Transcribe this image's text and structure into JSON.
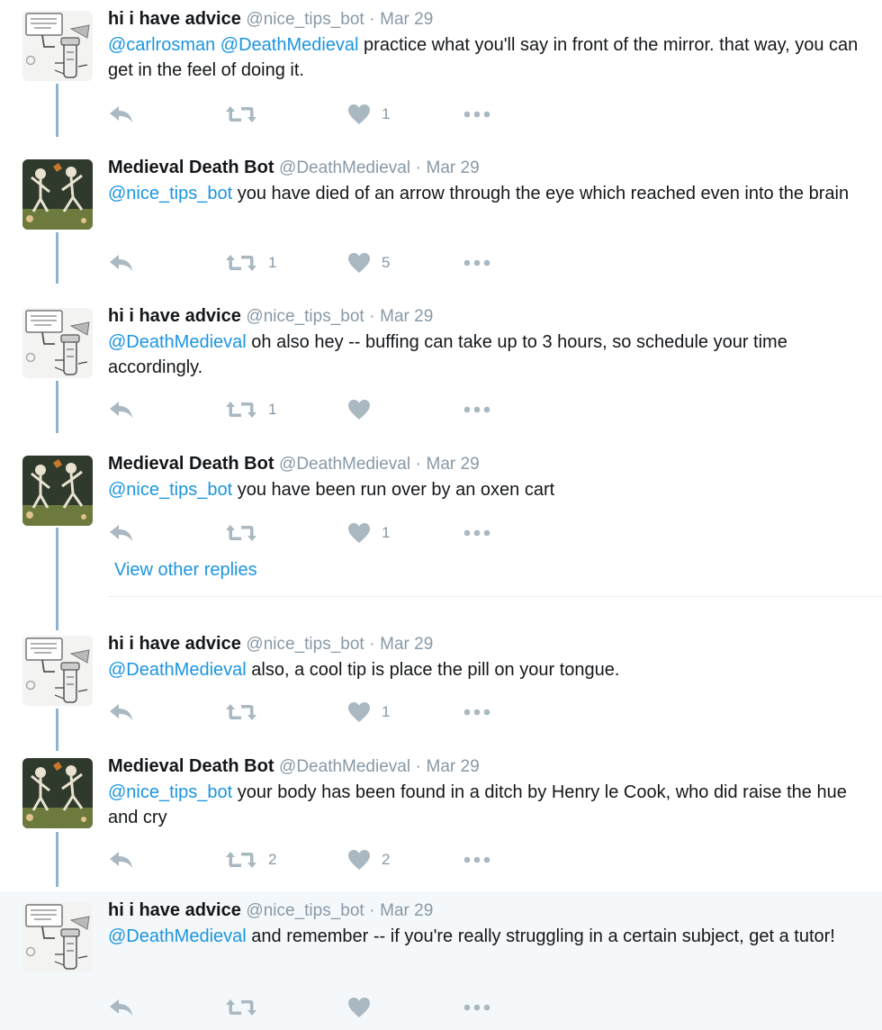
{
  "colors": {
    "mention": "#1b95e0",
    "meta": "#8899a6",
    "thread_line": "#8ab4cf",
    "highlight_bg": "#f5f8fa"
  },
  "tweets": [
    {
      "name": "hi i have advice",
      "handle": "@nice_tips_bot",
      "sep": "·",
      "date": "Mar 29",
      "mentions": "@carlrosman @DeathMedieval",
      "body": " practice what you'll say in front of the mirror. that way, you can get in the feel of doing it.",
      "retweets": "",
      "likes": "1",
      "avatar": "advice-bot"
    },
    {
      "name": "Medieval Death Bot",
      "handle": "@DeathMedieval",
      "sep": "·",
      "date": "Mar 29",
      "mentions": "@nice_tips_bot",
      "body": " you have died of an arrow through the eye which reached even into the brain",
      "retweets": "1",
      "likes": "5",
      "avatar": "skeletons"
    },
    {
      "name": "hi i have advice",
      "handle": "@nice_tips_bot",
      "sep": "·",
      "date": "Mar 29",
      "mentions": "@DeathMedieval",
      "body": " oh also hey -- buffing can take up to 3 hours, so schedule your time accordingly.",
      "retweets": "1",
      "likes": "",
      "avatar": "advice-bot"
    },
    {
      "name": "Medieval Death Bot",
      "handle": "@DeathMedieval",
      "sep": "·",
      "date": "Mar 29",
      "mentions": "@nice_tips_bot",
      "body": " you have been run over by an oxen cart",
      "retweets": "",
      "likes": "1",
      "avatar": "skeletons"
    },
    {
      "name": "hi i have advice",
      "handle": "@nice_tips_bot",
      "sep": "·",
      "date": "Mar 29",
      "mentions": "@DeathMedieval",
      "body": " also, a cool tip is place the pill on your tongue.",
      "retweets": "",
      "likes": "1",
      "avatar": "advice-bot"
    },
    {
      "name": "Medieval Death Bot",
      "handle": "@DeathMedieval",
      "sep": "·",
      "date": "Mar 29",
      "mentions": "@nice_tips_bot",
      "body": " your body has been found in a ditch by Henry le Cook, who did raise the hue and cry",
      "retweets": "2",
      "likes": "2",
      "avatar": "skeletons"
    },
    {
      "name": "hi i have advice",
      "handle": "@nice_tips_bot",
      "sep": "·",
      "date": "Mar 29",
      "mentions": "@DeathMedieval",
      "body": " and remember -- if you're really struggling in a certain subject, get a tutor!",
      "retweets": "",
      "likes": "",
      "avatar": "advice-bot"
    }
  ],
  "view_other_replies": "View other replies"
}
